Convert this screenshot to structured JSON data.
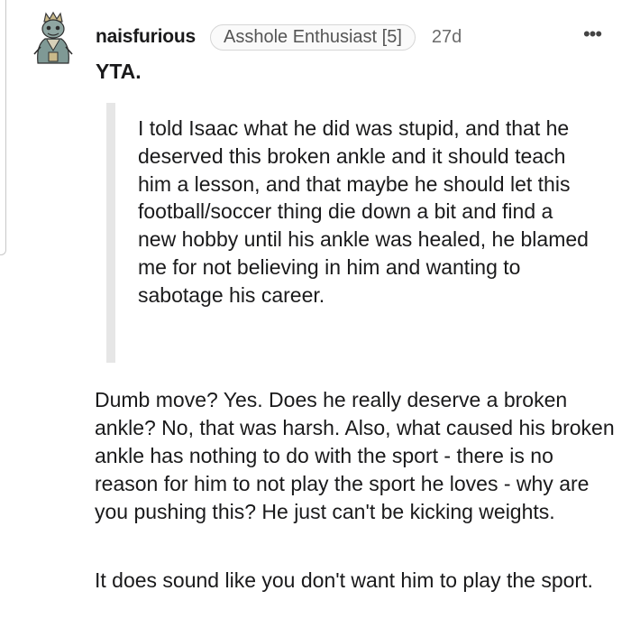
{
  "comment": {
    "username": "naisfurious",
    "flair": "Asshole Enthusiast [5]",
    "age": "27d",
    "more_label": "•••",
    "verdict": "YTA.",
    "quote": "I told Isaac what he did was stupid, and that he deserved this broken ankle and it should teach him a lesson, and that maybe he should let this football/soccer thing die down a bit and find a new hobby until his ankle was healed, he blamed me for not believing in him and wanting to sabotage his career.",
    "paragraphs": [
      "Dumb move? Yes. Does he really deserve a broken ankle? No, that was harsh. Also, what caused his broken ankle has nothing to do with the sport - there is no reason for him to not play the sport he loves - why are you pushing this? He just can't be kicking weights.",
      "It does sound like you don't want him to play the sport."
    ]
  },
  "icons": {
    "avatar": "avatar-icon",
    "more": "more-options-icon"
  }
}
